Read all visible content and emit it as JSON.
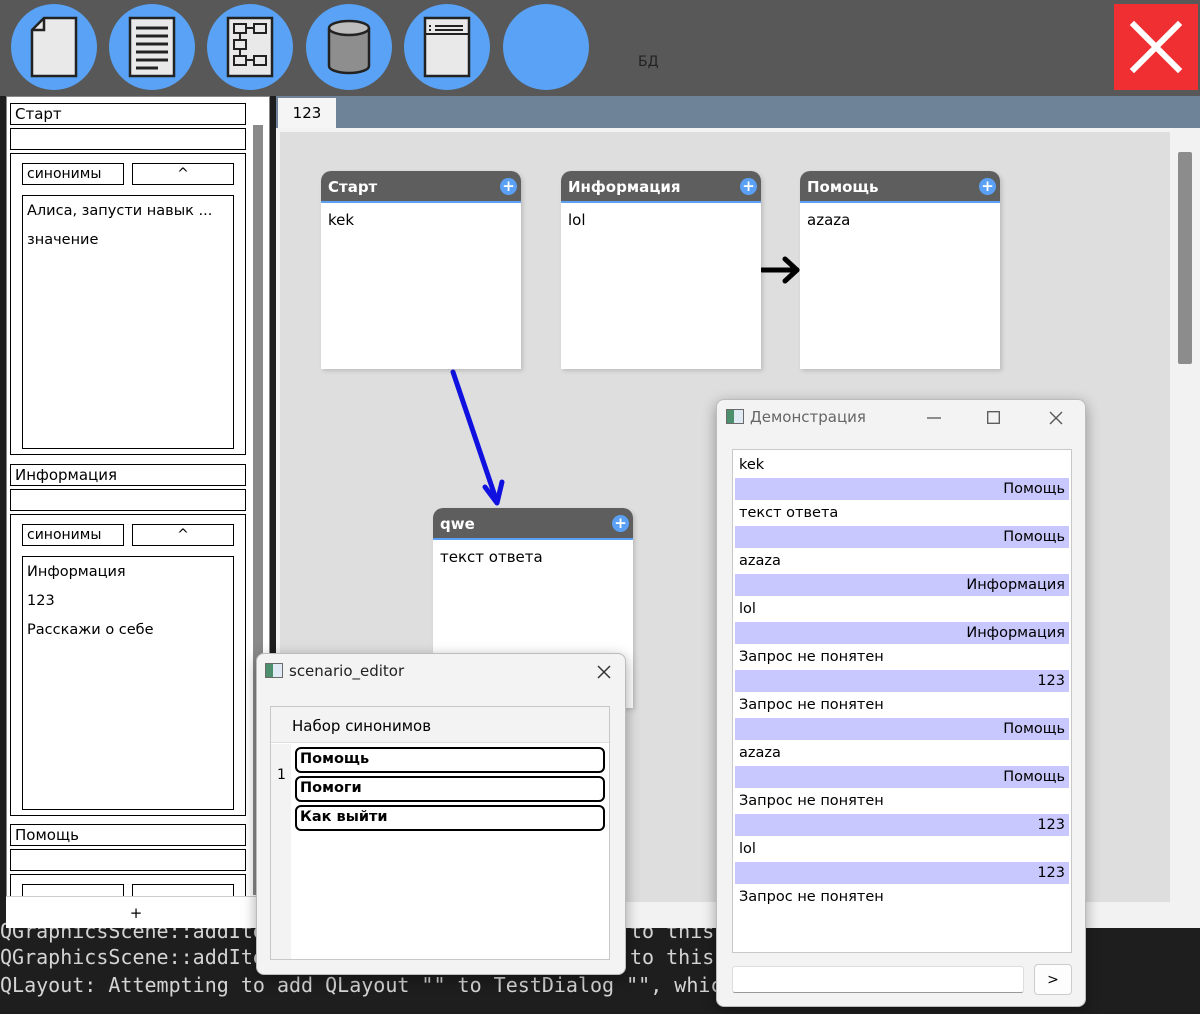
{
  "toolbar": {
    "buttons": [
      {
        "name": "new-file",
        "icon": "blank-page-icon"
      },
      {
        "name": "open-doc",
        "icon": "text-document-icon"
      },
      {
        "name": "flowchart",
        "icon": "flowchart-icon"
      },
      {
        "name": "database",
        "icon": "database-icon",
        "label": "БД"
      },
      {
        "name": "text-file",
        "icon": "text-file-icon"
      },
      {
        "name": "blank",
        "icon": "circle-icon"
      }
    ],
    "close_icon": "close-icon",
    "close_color": "#ef2f32",
    "accent": "#59a2f5"
  },
  "left_panel": {
    "sections": [
      {
        "title": "Старт",
        "synonyms_label": "синонимы",
        "toggle_label": "^",
        "items": [
          "Алиса, запусти навык ...",
          "значение"
        ]
      },
      {
        "title": "Информация",
        "synonyms_label": "синонимы",
        "toggle_label": "^",
        "items": [
          "Информация",
          "123",
          "Расскажи о себе"
        ]
      },
      {
        "title": "Помощь"
      }
    ],
    "add_label": "+"
  },
  "console": {
    "lines": [
      "QGraphicsScene::addIte",
      "QGraphicsScene::addIte",
      "QLayout: Attempting to add QLayout \"\" to TestDialog \"\", which"
    ],
    "right_fragments": [
      "to this",
      "to this"
    ]
  },
  "canvas": {
    "tab_label": "123",
    "nodes": [
      {
        "title": "Старт",
        "body": "kek"
      },
      {
        "title": "Информация",
        "body": "lol"
      },
      {
        "title": "Помощь",
        "body": "azaza"
      },
      {
        "title": "qwe",
        "body": "текст ответа"
      }
    ]
  },
  "scenario_editor": {
    "title": "scenario_editor",
    "header": "Набор синонимов",
    "row_number": "1",
    "synonyms": [
      "Помощь",
      "Помоги",
      "Как выйти"
    ]
  },
  "demo": {
    "title": "Демонстрация",
    "messages": [
      {
        "from": "user",
        "text": "kek"
      },
      {
        "from": "bot",
        "text": "Помощь"
      },
      {
        "from": "user",
        "text": "текст ответа"
      },
      {
        "from": "bot",
        "text": "Помощь"
      },
      {
        "from": "user",
        "text": "azaza"
      },
      {
        "from": "bot",
        "text": "Информация"
      },
      {
        "from": "user",
        "text": "lol"
      },
      {
        "from": "bot",
        "text": "Информация"
      },
      {
        "from": "user",
        "text": "Запрос не понятен"
      },
      {
        "from": "bot",
        "text": "123"
      },
      {
        "from": "user",
        "text": "Запрос не понятен"
      },
      {
        "from": "bot",
        "text": "Помощь"
      },
      {
        "from": "user",
        "text": "azaza"
      },
      {
        "from": "bot",
        "text": "Помощь"
      },
      {
        "from": "user",
        "text": "Запрос не понятен"
      },
      {
        "from": "bot",
        "text": "123"
      },
      {
        "from": "user",
        "text": "lol"
      },
      {
        "from": "bot",
        "text": "123"
      },
      {
        "from": "user",
        "text": "Запрос не понятен"
      }
    ],
    "input_value": "",
    "send_label": ">",
    "bot_bubble_color": "#c8c8ff"
  }
}
